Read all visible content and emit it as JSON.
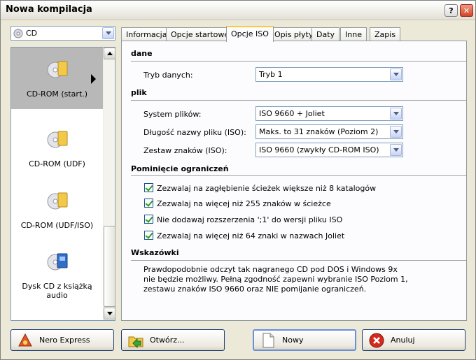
{
  "window": {
    "title": "Nowa kompilacja",
    "help_glyph": "?",
    "close_glyph": "✕"
  },
  "left": {
    "disc_combo": "CD",
    "items": [
      {
        "label": "CD-ROM (start.)",
        "selected": true
      },
      {
        "label": "CD-ROM (UDF)",
        "selected": false
      },
      {
        "label": "CD-ROM (UDF/ISO)",
        "selected": false
      },
      {
        "label": "Dysk CD z książką audio",
        "selected": false
      }
    ]
  },
  "tabs": [
    {
      "label": "Informacja"
    },
    {
      "label": "Opcje startowe"
    },
    {
      "label": "Opcje ISO",
      "active": true
    },
    {
      "label": "Opis płyty"
    },
    {
      "label": "Daty"
    },
    {
      "label": "Inne"
    },
    {
      "label": "Zapis"
    }
  ],
  "iso": {
    "section_data": "dane",
    "data_mode_label": "Tryb danych:",
    "data_mode_value": "Tryb 1",
    "section_file": "plik",
    "fs_label": "System plików:",
    "fs_value": "ISO 9660 + Joliet",
    "name_len_label": "Długość nazwy pliku (ISO):",
    "name_len_value": "Maks. to 31 znaków (Poziom 2)",
    "charset_label": "Zestaw znaków (ISO):",
    "charset_value": "ISO 9660 (zwykły CD-ROM ISO)",
    "section_restrictions": "Pominięcie ograniczeń",
    "checkboxes": [
      {
        "label": "Zezwalaj na zagłębienie ścieżek większe niż 8 katalogów",
        "checked": true
      },
      {
        "label": "Zezwalaj na więcej niż 255 znaków w ścieżce",
        "checked": true
      },
      {
        "label": "Nie dodawaj rozszerzenia ';1' do wersji pliku ISO",
        "checked": true
      },
      {
        "label": "Zezwalaj na więcej niż 64 znaki w nazwach Joliet",
        "checked": true
      }
    ],
    "section_hints": "Wskazówki",
    "hint_text": "Prawdopodobnie odczyt tak nagranego CD pod DOS i Windows 9x nie będzie możliwy. Pełną zgodność zapewni wybranie ISO Poziom 1, zestawu znaków ISO 9660 oraz NIE pomijanie ograniczeń."
  },
  "buttons": {
    "nero_express": "Nero Express",
    "open": "Otwórz...",
    "new": "Nowy",
    "cancel": "Anuluj"
  },
  "colors": {
    "tab_highlight": "#ffc83c",
    "check_green": "#21a121",
    "cancel_red": "#d42a1e"
  }
}
